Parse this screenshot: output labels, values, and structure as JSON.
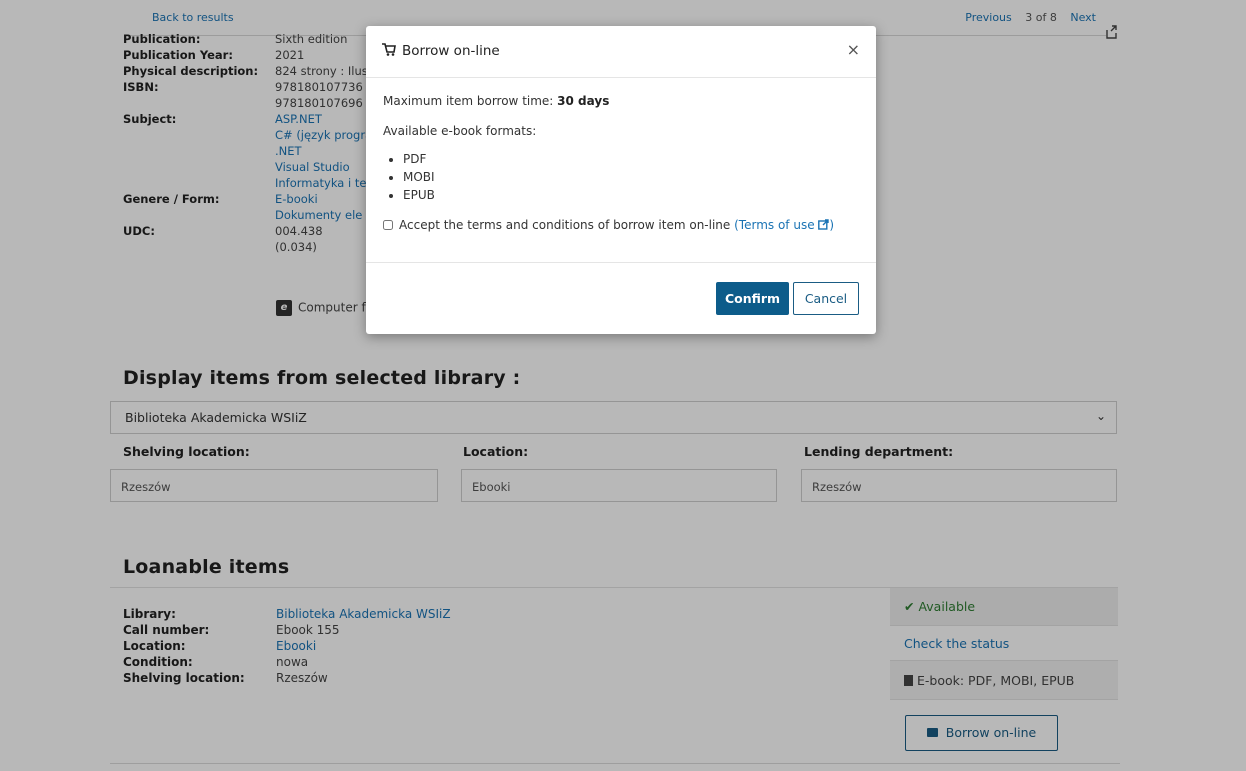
{
  "nav": {
    "back": "Back to results",
    "previous": "Previous",
    "count": "3 of 8",
    "next": "Next"
  },
  "details": {
    "publication_label": "Publication:",
    "publication_value": "Sixth edition",
    "year_label": "Publication Year:",
    "year_value": "2021",
    "physical_label": "Physical description:",
    "physical_value": "824 strony : Ilus",
    "isbn_label": "ISBN:",
    "isbn_1": "978180107736",
    "isbn_2": "978180107696",
    "subject_label": "Subject:",
    "subjects": [
      "ASP.NET",
      "C# (język progra",
      ".NET",
      "Visual Studio",
      "Informatyka i te"
    ],
    "genre_label": "Genere / Form:",
    "genres": [
      "E-booki",
      "Dokumenty ele"
    ],
    "udc_label": "UDC:",
    "udc_1": "004.438",
    "udc_2": "(0.034)",
    "format": "Computer f"
  },
  "display_items": {
    "title": "Display items from selected library :",
    "selected_library": "Biblioteka Akademicka WSIiZ",
    "shelving_label": "Shelving location:",
    "shelving_value": "Rzeszów",
    "location_label": "Location:",
    "location_value": "Ebooki",
    "lending_label": "Lending department:",
    "lending_value": "Rzeszów"
  },
  "loanable": {
    "title": "Loanable items",
    "library_label": "Library:",
    "library_value": "Biblioteka Akademicka WSIiZ",
    "call_label": "Call number:",
    "call_value": "Ebook 155",
    "location_label": "Location:",
    "location_value": "Ebooki",
    "condition_label": "Condition:",
    "condition_value": "nowa",
    "shelving_label": "Shelving location:",
    "shelving_value": "Rzeszów",
    "status_available": "Available",
    "check_status": "Check the status",
    "ebook_formats": "E-book: PDF, MOBI, EPUB",
    "borrow_button": "Borrow on-line"
  },
  "modal": {
    "title": "Borrow on-line",
    "max_time_label": "Maximum item borrow time:",
    "max_time_value": "30 days",
    "formats_label": "Available e-book formats:",
    "formats": [
      "PDF",
      "MOBI",
      "EPUB"
    ],
    "terms_text": "Accept the terms and conditions of borrow item on-line",
    "terms_link": "(Terms of use",
    "terms_link_end": ")",
    "confirm": "Confirm",
    "cancel": "Cancel"
  },
  "colors": {
    "link": "#1a73b4",
    "primary_button": "#0d5c8a",
    "available": "#2e7d32"
  }
}
